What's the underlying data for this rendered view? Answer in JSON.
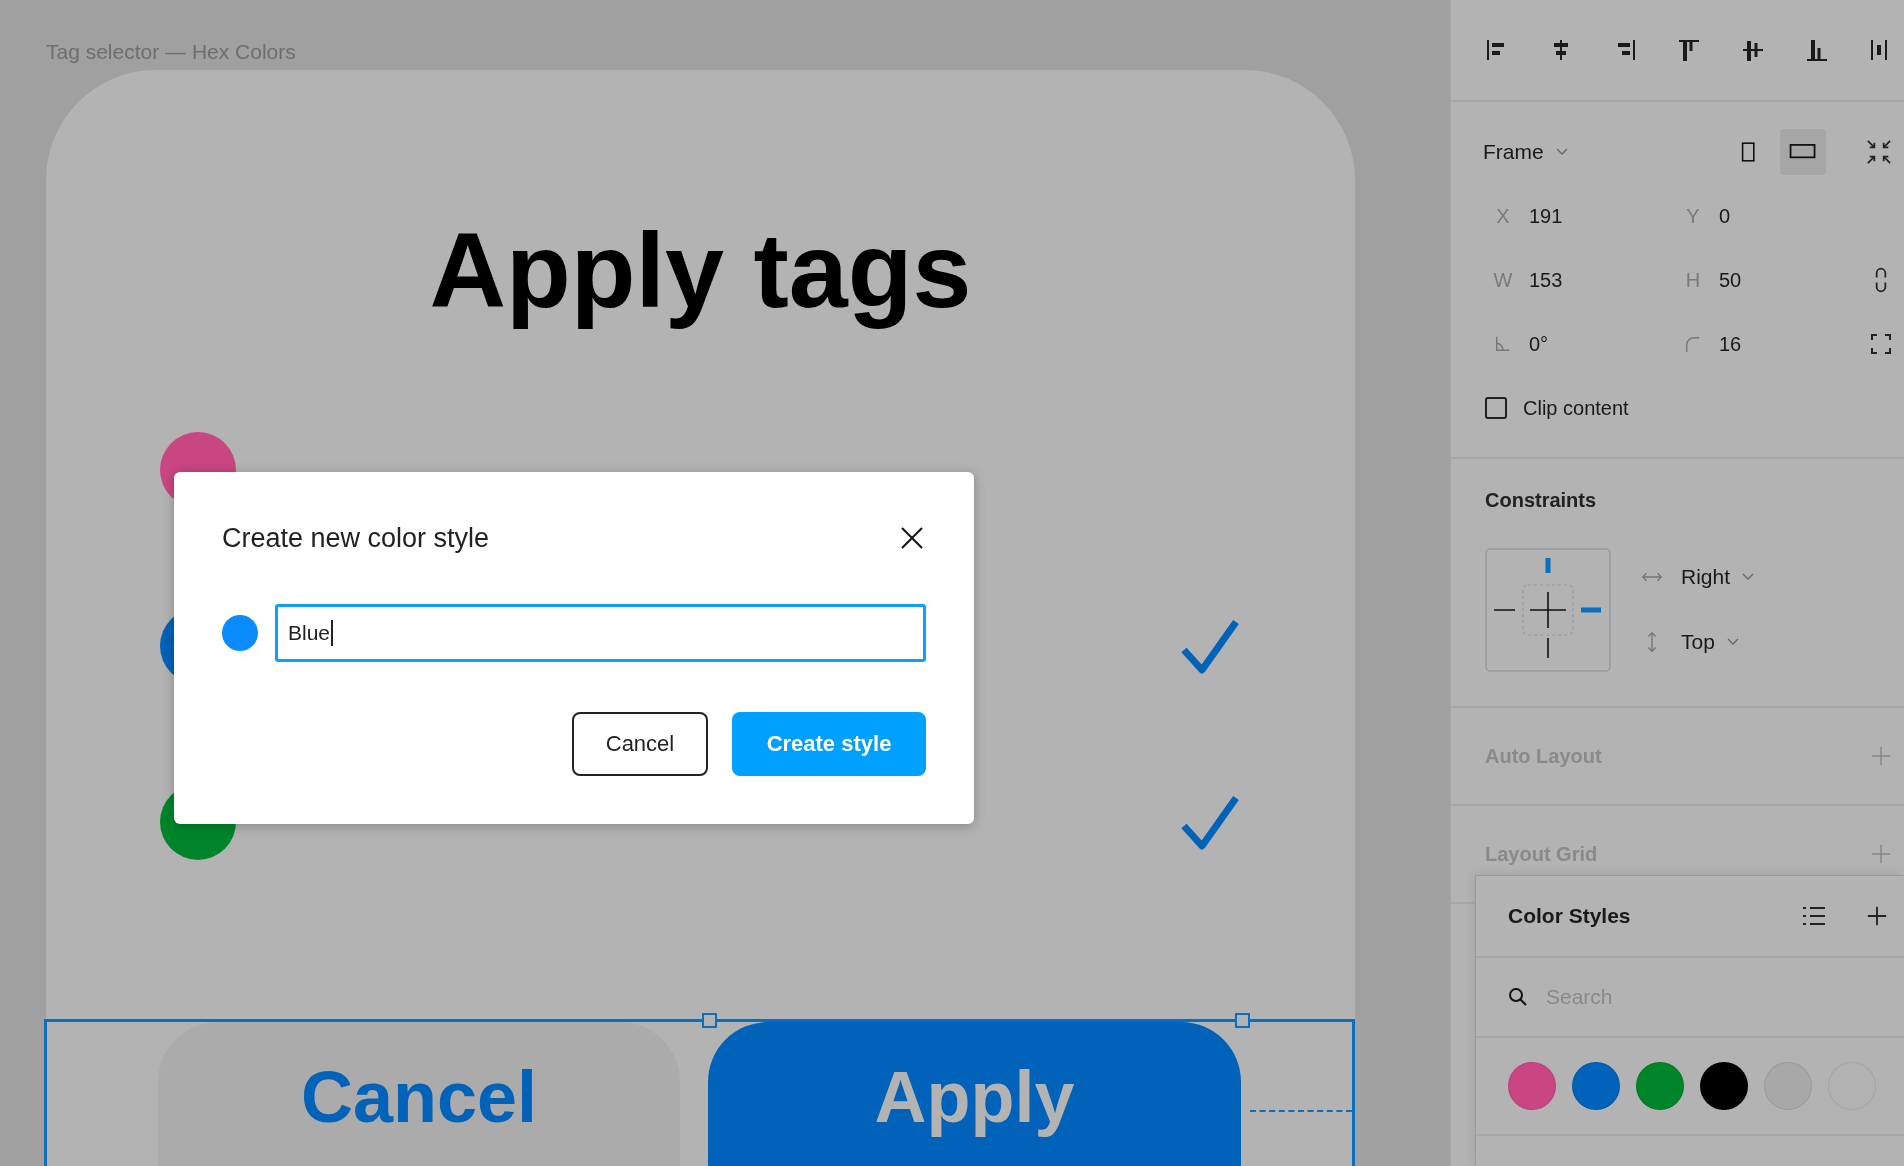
{
  "canvas": {
    "frame_label": "Tag selector — Hex Colors",
    "title": "Apply tags",
    "tags": [
      {
        "color": "#c94683",
        "checked": false
      },
      {
        "color": "#0062b8",
        "checked": true
      },
      {
        "color": "#00852a",
        "checked": true
      }
    ],
    "buttons": [
      {
        "label": "Cancel",
        "kind": "secondary"
      },
      {
        "label": "Apply",
        "kind": "primary"
      }
    ]
  },
  "dialog": {
    "title": "Create new color style",
    "color": "#0a8cff",
    "value": "Blue",
    "buttons": [
      {
        "label": "Cancel",
        "kind": "secondary"
      },
      {
        "label": "Create style",
        "kind": "primary"
      }
    ]
  },
  "panel": {
    "frame": {
      "label": "Frame",
      "orientations": [
        {
          "kind": "portrait",
          "selected": false
        },
        {
          "kind": "landscape",
          "selected": true
        }
      ],
      "fields": [
        {
          "kind": "text",
          "label": "X",
          "value": "191"
        },
        {
          "kind": "text",
          "label": "Y",
          "value": "0"
        },
        {
          "kind": "text",
          "label": "W",
          "value": "153"
        },
        {
          "kind": "text",
          "label": "H",
          "value": "50"
        },
        {
          "kind": "angle",
          "value": "0°"
        },
        {
          "kind": "radius",
          "value": "16"
        }
      ],
      "clip_content": {
        "label": "Clip content",
        "checked": false
      }
    },
    "constraints": {
      "title": "Constraints",
      "horizontal": "Right",
      "vertical": "Top"
    },
    "sections": [
      {
        "title": "Auto Layout"
      },
      {
        "title": "Layout Grid"
      }
    ],
    "color_styles": {
      "title": "Color Styles",
      "search_placeholder": "Search",
      "swatches": [
        {
          "color": "#c94683"
        },
        {
          "color": "#0062b8"
        },
        {
          "color": "#00852a"
        },
        {
          "color": "#000000"
        },
        {
          "color": "#a8a8a8"
        },
        {
          "color": "#b3b3b3"
        }
      ]
    }
  }
}
